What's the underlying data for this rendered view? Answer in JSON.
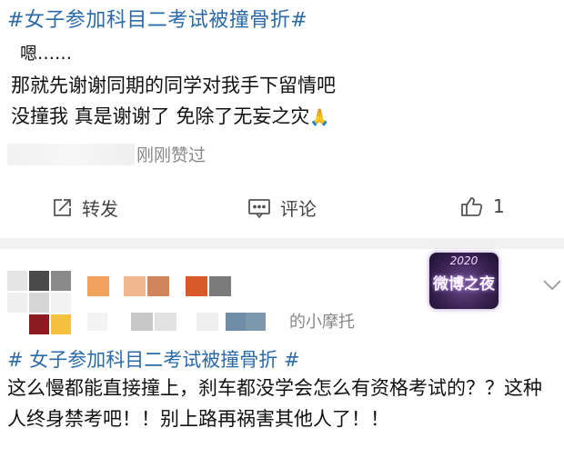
{
  "post1": {
    "topic": "#女子参加科目二考试被撞骨折#",
    "lines": [
      "嗯……",
      "那就先谢谢同期的同学对我手下留情吧",
      "没撞我 真是谢谢了 免除了无妄之灾"
    ],
    "emoji": "🙏",
    "liked_text": "刚刚赞过",
    "actions": {
      "share": "转发",
      "comment": "评论",
      "like_count": "1"
    }
  },
  "post2": {
    "source_suffix": "的小摩托",
    "badge": {
      "year": "2020",
      "text": "微博之夜"
    },
    "topic": "# 女子参加科目二考试被撞骨折 #",
    "body": "这么慢都能直接撞上，刹车都没学会怎么有资格考试的？？这种人终身禁考吧！！别上路再祸害其他人了！！"
  },
  "icons": {
    "share": "share-icon",
    "comment": "comment-icon",
    "like": "thumbs-up-icon",
    "more": "chevron-down-icon"
  },
  "colors": {
    "topic": "#2b6aa8",
    "muted": "#888888",
    "separator": "#f1f1f1",
    "mosaic": [
      "#e7e7e7",
      "#4a4a4a",
      "#8f8f8f",
      "#f1a25c",
      "#cf8459",
      "#d85a2a",
      "#c8c8c8",
      "#8c1c22",
      "#f3c040",
      "#6f8da6"
    ]
  }
}
